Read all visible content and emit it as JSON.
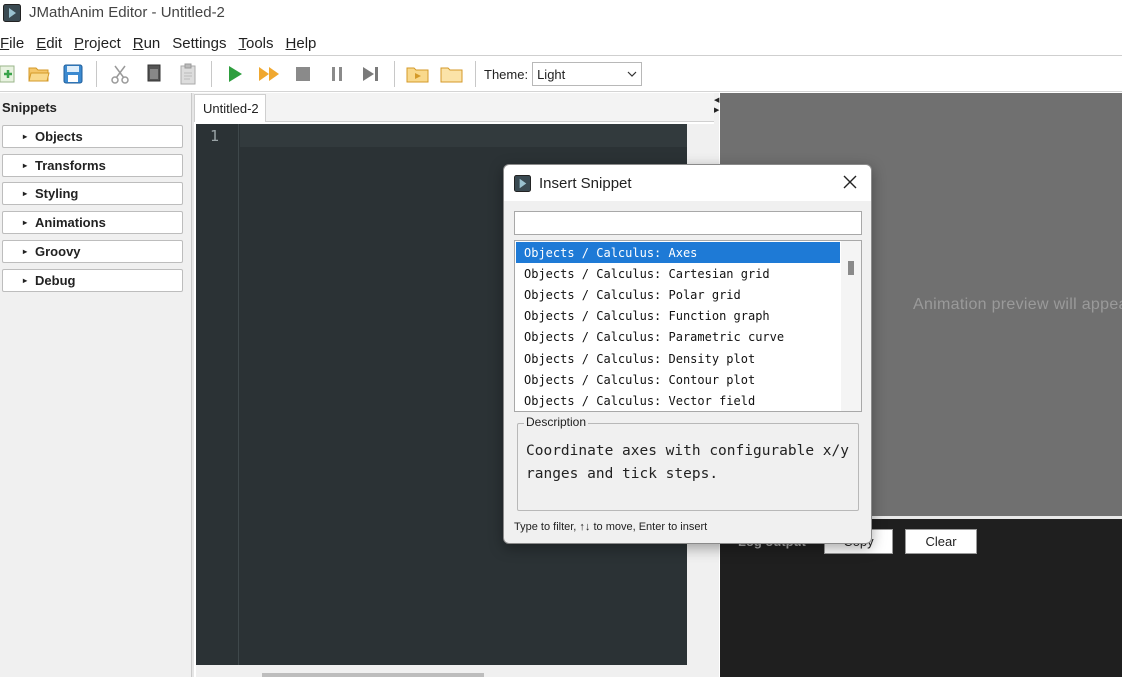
{
  "window": {
    "title": "JMathAnim Editor - Untitled-2"
  },
  "menu": [
    {
      "mnemonic": "F",
      "rest": "ile"
    },
    {
      "mnemonic": "E",
      "rest": "dit"
    },
    {
      "mnemonic": "P",
      "rest": "roject"
    },
    {
      "mnemonic": "R",
      "rest": "un"
    },
    {
      "mnemonic": "",
      "rest": "Settings"
    },
    {
      "mnemonic": "T",
      "rest": "ools"
    },
    {
      "mnemonic": "H",
      "rest": "elp"
    }
  ],
  "toolbar": {
    "theme_label": "Theme:",
    "theme_value": "Light",
    "icons": [
      "new-file-icon",
      "open-folder-icon",
      "save-icon",
      "cut-icon",
      "copy-icon",
      "paste-icon",
      "run-icon",
      "fast-forward-icon",
      "stop-icon",
      "pause-icon",
      "step-forward-icon",
      "open-preview-icon",
      "folder-icon"
    ]
  },
  "sidebar": {
    "title": "Snippets",
    "items": [
      "Objects",
      "Transforms",
      "Styling",
      "Animations",
      "Groovy",
      "Debug"
    ]
  },
  "editor": {
    "tab": "Untitled-2",
    "line_number": "1"
  },
  "preview": {
    "placeholder": "Animation preview will appear here"
  },
  "log": {
    "label": "Log output",
    "copy_label": "Copy",
    "clear_label": "Clear"
  },
  "dialog": {
    "title": "Insert Snippet",
    "search_value": "",
    "items": [
      "Objects / Calculus: Axes",
      "Objects / Calculus: Cartesian grid",
      "Objects / Calculus: Polar grid",
      "Objects / Calculus: Function graph",
      "Objects / Calculus: Parametric curve",
      "Objects / Calculus: Density plot",
      "Objects / Calculus: Contour plot",
      "Objects / Calculus: Vector field"
    ],
    "selected_index": 0,
    "description_label": "Description",
    "description": "Coordinate axes with configurable x/y ranges and tick steps.",
    "hint": "Type to filter, ↑↓ to move, Enter to insert"
  },
  "colors": {
    "selection": "#1e7ad6",
    "editor_bg": "#2b3235",
    "preview_bg": "#707070",
    "log_bg": "#1f1f1f",
    "run_green": "#2e9e3e",
    "folder_orange": "#f0a830"
  }
}
